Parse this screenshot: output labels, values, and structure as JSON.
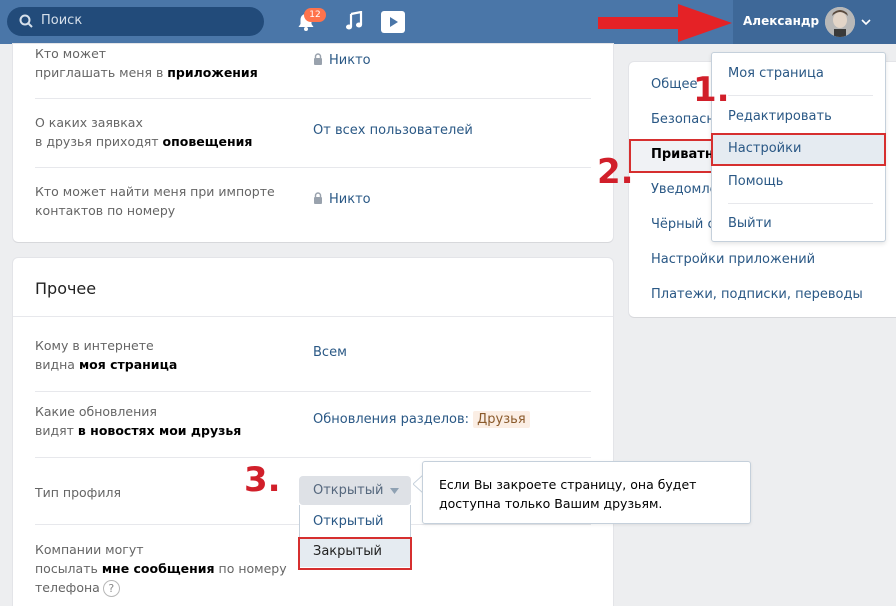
{
  "header": {
    "search_placeholder": "Поиск",
    "notifications_count": "12",
    "user_name": "Александр"
  },
  "privacy_rows": [
    {
      "label_plain": "Кто может",
      "label_line2_plain": "приглашать меня в ",
      "label_line2_bold": "приложения",
      "value": "Никто"
    },
    {
      "label_plain": "О каких заявках",
      "label_line2_plain": "в друзья приходят ",
      "label_line2_bold": "оповещения",
      "value": "От всех пользователей"
    },
    {
      "label_plain": "Кто может найти меня при импорте",
      "label_line2_plain": "контактов по номеру",
      "value": "Никто"
    }
  ],
  "other_section": {
    "title": "Прочее",
    "rows": [
      {
        "label_line1": "Кому в интернете",
        "label_line2_plain": "видна ",
        "label_line2_bold": "моя страница",
        "value": "Всем"
      },
      {
        "label_line1": "Какие обновления",
        "label_line2_plain": "видят ",
        "label_line2_bold": "в новостях мои друзья",
        "value": "Обновления разделов:",
        "chip": "Друзья"
      },
      {
        "label_line1": "Тип профиля"
      },
      {
        "label_line1": "Компании могут",
        "label_line2_plain": "посылать ",
        "label_line2_bold": "мне сообщения",
        "label_line2_tail": " по номеру",
        "label_line3": "телефона",
        "help": "?"
      }
    ]
  },
  "profile_type": {
    "selected": "Открытый",
    "options": [
      "Открытый",
      "Закрытый"
    ]
  },
  "tooltip_text": "Если Вы закроете страницу, она будет доступна только Вашим друзьям.",
  "settings_menu": [
    {
      "label": "Общее"
    },
    {
      "label": "Безопасность"
    },
    {
      "label": "Приватность",
      "active": true
    },
    {
      "label": "Уведомления"
    },
    {
      "label": "Чёрный список"
    },
    {
      "label": "Настройки приложений"
    },
    {
      "label": "Платежи, подписки, переводы"
    }
  ],
  "user_menu": {
    "items": [
      "Моя страница",
      "Редактировать",
      "Настройки",
      "Помощь",
      "Выйти"
    ]
  },
  "annotations": {
    "step1": "1.",
    "step2": "2.",
    "step3": "3."
  },
  "colors": {
    "header": "#4a76a8",
    "link": "#2a5885",
    "annotation": "#d62f2f"
  }
}
